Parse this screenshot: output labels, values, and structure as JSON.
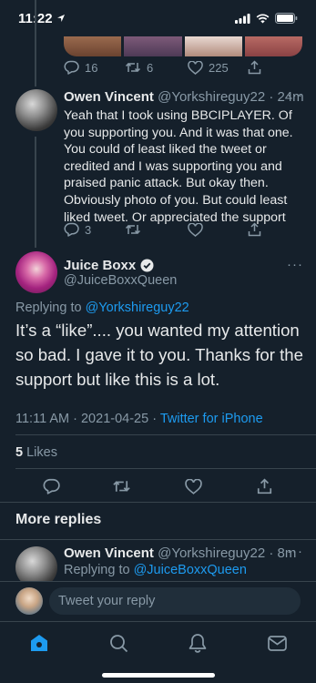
{
  "status": {
    "time": "11:22"
  },
  "parent_actions": {
    "replies": "16",
    "retweets": "6",
    "likes": "225"
  },
  "reply1": {
    "name": "Owen Vincent",
    "handle_time": "@Yorkshireguy22 · 24m",
    "text": "Yeah that I took using BBCIPLAYER. Of you supporting you. And it was that one. You could of least liked the tweet or credited and I was supporting you and praised panic attack. But okay then. Obviously photo of you. But could least liked tweet. Or appreciated the support",
    "replies": "3"
  },
  "main_tweet": {
    "name": "Juice Boxx",
    "handle": "@JuiceBoxxQueen",
    "replying_prefix": "Replying to",
    "replying_to": "@Yorkshireguy22",
    "text": "It’s a “like”.... you wanted my attention so bad. I gave it to you. Thanks for the support but like this is a lot.",
    "time_date": "11:11 AM · 2021-04-25 ·",
    "source": "Twitter for iPhone",
    "likes_count": "5",
    "likes_label": "Likes"
  },
  "more_replies": {
    "title": "More replies"
  },
  "reply2": {
    "name": "Owen Vincent",
    "handle_time": "@Yorkshireguy22 · 8m",
    "replying_prefix": "Replying to",
    "replying_to": "@JuiceBoxxQueen"
  },
  "composer": {
    "placeholder": "Tweet your reply"
  },
  "colors": {
    "background": "#15202b",
    "accent": "#1d9bf0",
    "muted": "#8899a6",
    "divider": "#38444d"
  },
  "icons": [
    "location-arrow-icon",
    "signal-icon",
    "wifi-icon",
    "battery-icon",
    "reply-icon",
    "retweet-icon",
    "like-icon",
    "share-icon",
    "more-icon",
    "verified-badge-icon",
    "home-icon",
    "search-icon",
    "notifications-icon",
    "messages-icon"
  ]
}
